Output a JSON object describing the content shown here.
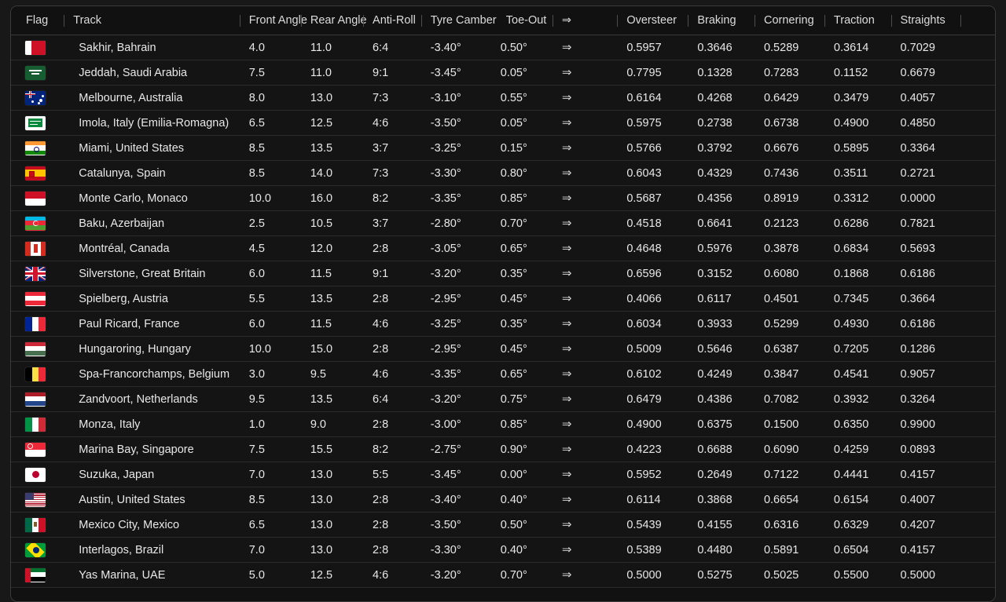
{
  "table": {
    "columns": [
      {
        "key": "flag",
        "label": "Flag",
        "sep": false
      },
      {
        "key": "track",
        "label": "Track",
        "sep": true
      },
      {
        "key": "front",
        "label": "Front Angle",
        "sep": true
      },
      {
        "key": "rear",
        "label": "Rear Angle",
        "sep": true
      },
      {
        "key": "anti",
        "label": "Anti-Roll",
        "sep": true
      },
      {
        "key": "camber",
        "label": "Tyre Camber",
        "sep": true
      },
      {
        "key": "toe",
        "label": "Toe-Out",
        "sep": false
      },
      {
        "key": "arrow",
        "label": "⇒",
        "sep": true
      },
      {
        "key": "oversteer",
        "label": "Oversteer",
        "sep": true
      },
      {
        "key": "braking",
        "label": "Braking",
        "sep": true
      },
      {
        "key": "cornering",
        "label": "Cornering",
        "sep": true
      },
      {
        "key": "traction",
        "label": "Traction",
        "sep": true
      },
      {
        "key": "straights",
        "label": "Straights",
        "sep": true
      },
      {
        "key": "end",
        "label": "",
        "sep": true
      }
    ],
    "arrow_glyph": "⇒",
    "rows": [
      {
        "flag": "bahrain",
        "track": "Sakhir, Bahrain",
        "front": "4.0",
        "rear": "11.0",
        "anti": "6:4",
        "camber": "-3.40°",
        "toe": "0.50°",
        "oversteer": "0.5957",
        "braking": "0.3646",
        "cornering": "0.5289",
        "traction": "0.3614",
        "straights": "0.7029"
      },
      {
        "flag": "saudi-arabia",
        "track": "Jeddah, Saudi Arabia",
        "front": "7.5",
        "rear": "11.0",
        "anti": "9:1",
        "camber": "-3.45°",
        "toe": "0.05°",
        "oversteer": "0.7795",
        "braking": "0.1328",
        "cornering": "0.7283",
        "traction": "0.1152",
        "straights": "0.6679"
      },
      {
        "flag": "australia",
        "track": "Melbourne, Australia",
        "front": "8.0",
        "rear": "13.0",
        "anti": "7:3",
        "camber": "-3.10°",
        "toe": "0.55°",
        "oversteer": "0.6164",
        "braking": "0.4268",
        "cornering": "0.6429",
        "traction": "0.3479",
        "straights": "0.4057"
      },
      {
        "flag": "emilia-romagna",
        "track": "Imola, Italy (Emilia-Romagna)",
        "front": "6.5",
        "rear": "12.5",
        "anti": "4:6",
        "camber": "-3.50°",
        "toe": "0.05°",
        "oversteer": "0.5975",
        "braking": "0.2738",
        "cornering": "0.6738",
        "traction": "0.4900",
        "straights": "0.4850"
      },
      {
        "flag": "india",
        "track": "Miami, United States",
        "front": "8.5",
        "rear": "13.5",
        "anti": "3:7",
        "camber": "-3.25°",
        "toe": "0.15°",
        "oversteer": "0.5766",
        "braking": "0.3792",
        "cornering": "0.6676",
        "traction": "0.5895",
        "straights": "0.3364"
      },
      {
        "flag": "spain",
        "track": "Catalunya, Spain",
        "front": "8.5",
        "rear": "14.0",
        "anti": "7:3",
        "camber": "-3.30°",
        "toe": "0.80°",
        "oversteer": "0.6043",
        "braking": "0.4329",
        "cornering": "0.7436",
        "traction": "0.3511",
        "straights": "0.2721"
      },
      {
        "flag": "monaco",
        "track": "Monte Carlo, Monaco",
        "front": "10.0",
        "rear": "16.0",
        "anti": "8:2",
        "camber": "-3.35°",
        "toe": "0.85°",
        "oversteer": "0.5687",
        "braking": "0.4356",
        "cornering": "0.8919",
        "traction": "0.3312",
        "straights": "0.0000"
      },
      {
        "flag": "azerbaijan",
        "track": "Baku, Azerbaijan",
        "front": "2.5",
        "rear": "10.5",
        "anti": "3:7",
        "camber": "-2.80°",
        "toe": "0.70°",
        "oversteer": "0.4518",
        "braking": "0.6641",
        "cornering": "0.2123",
        "traction": "0.6286",
        "straights": "0.7821"
      },
      {
        "flag": "canada",
        "track": "Montréal, Canada",
        "front": "4.5",
        "rear": "12.0",
        "anti": "2:8",
        "camber": "-3.05°",
        "toe": "0.65°",
        "oversteer": "0.4648",
        "braking": "0.5976",
        "cornering": "0.3878",
        "traction": "0.6834",
        "straights": "0.5693"
      },
      {
        "flag": "great-britain",
        "track": "Silverstone, Great Britain",
        "front": "6.0",
        "rear": "11.5",
        "anti": "9:1",
        "camber": "-3.20°",
        "toe": "0.35°",
        "oversteer": "0.6596",
        "braking": "0.3152",
        "cornering": "0.6080",
        "traction": "0.1868",
        "straights": "0.6186"
      },
      {
        "flag": "austria",
        "track": "Spielberg, Austria",
        "front": "5.5",
        "rear": "13.5",
        "anti": "2:8",
        "camber": "-2.95°",
        "toe": "0.45°",
        "oversteer": "0.4066",
        "braking": "0.6117",
        "cornering": "0.4501",
        "traction": "0.7345",
        "straights": "0.3664"
      },
      {
        "flag": "france",
        "track": "Paul Ricard, France",
        "front": "6.0",
        "rear": "11.5",
        "anti": "4:6",
        "camber": "-3.25°",
        "toe": "0.35°",
        "oversteer": "0.6034",
        "braking": "0.3933",
        "cornering": "0.5299",
        "traction": "0.4930",
        "straights": "0.6186"
      },
      {
        "flag": "hungary",
        "track": "Hungaroring, Hungary",
        "front": "10.0",
        "rear": "15.0",
        "anti": "2:8",
        "camber": "-2.95°",
        "toe": "0.45°",
        "oversteer": "0.5009",
        "braking": "0.5646",
        "cornering": "0.6387",
        "traction": "0.7205",
        "straights": "0.1286"
      },
      {
        "flag": "belgium",
        "track": "Spa-Francorchamps, Belgium",
        "front": "3.0",
        "rear": "9.5",
        "anti": "4:6",
        "camber": "-3.35°",
        "toe": "0.65°",
        "oversteer": "0.6102",
        "braking": "0.4249",
        "cornering": "0.3847",
        "traction": "0.4541",
        "straights": "0.9057"
      },
      {
        "flag": "netherlands",
        "track": "Zandvoort, Netherlands",
        "front": "9.5",
        "rear": "13.5",
        "anti": "6:4",
        "camber": "-3.20°",
        "toe": "0.75°",
        "oversteer": "0.6479",
        "braking": "0.4386",
        "cornering": "0.7082",
        "traction": "0.3932",
        "straights": "0.3264"
      },
      {
        "flag": "italy",
        "track": "Monza, Italy",
        "front": "1.0",
        "rear": "9.0",
        "anti": "2:8",
        "camber": "-3.00°",
        "toe": "0.85°",
        "oversteer": "0.4900",
        "braking": "0.6375",
        "cornering": "0.1500",
        "traction": "0.6350",
        "straights": "0.9900"
      },
      {
        "flag": "singapore",
        "track": "Marina Bay, Singapore",
        "front": "7.5",
        "rear": "15.5",
        "anti": "8:2",
        "camber": "-2.75°",
        "toe": "0.90°",
        "oversteer": "0.4223",
        "braking": "0.6688",
        "cornering": "0.6090",
        "traction": "0.4259",
        "straights": "0.0893"
      },
      {
        "flag": "japan",
        "track": "Suzuka, Japan",
        "front": "7.0",
        "rear": "13.0",
        "anti": "5:5",
        "camber": "-3.45°",
        "toe": "0.00°",
        "oversteer": "0.5952",
        "braking": "0.2649",
        "cornering": "0.7122",
        "traction": "0.4441",
        "straights": "0.4157"
      },
      {
        "flag": "united-states",
        "track": "Austin, United States",
        "front": "8.5",
        "rear": "13.0",
        "anti": "2:8",
        "camber": "-3.40°",
        "toe": "0.40°",
        "oversteer": "0.6114",
        "braking": "0.3868",
        "cornering": "0.6654",
        "traction": "0.6154",
        "straights": "0.4007"
      },
      {
        "flag": "mexico",
        "track": "Mexico City, Mexico",
        "front": "6.5",
        "rear": "13.0",
        "anti": "2:8",
        "camber": "-3.50°",
        "toe": "0.50°",
        "oversteer": "0.5439",
        "braking": "0.4155",
        "cornering": "0.6316",
        "traction": "0.6329",
        "straights": "0.4207"
      },
      {
        "flag": "brazil",
        "track": "Interlagos, Brazil",
        "front": "7.0",
        "rear": "13.0",
        "anti": "2:8",
        "camber": "-3.30°",
        "toe": "0.40°",
        "oversteer": "0.5389",
        "braking": "0.4480",
        "cornering": "0.5891",
        "traction": "0.6504",
        "straights": "0.4157"
      },
      {
        "flag": "uae",
        "track": "Yas Marina, UAE",
        "front": "5.0",
        "rear": "12.5",
        "anti": "4:6",
        "camber": "-3.20°",
        "toe": "0.70°",
        "oversteer": "0.5000",
        "braking": "0.5275",
        "cornering": "0.5025",
        "traction": "0.5500",
        "straights": "0.5000"
      }
    ]
  }
}
